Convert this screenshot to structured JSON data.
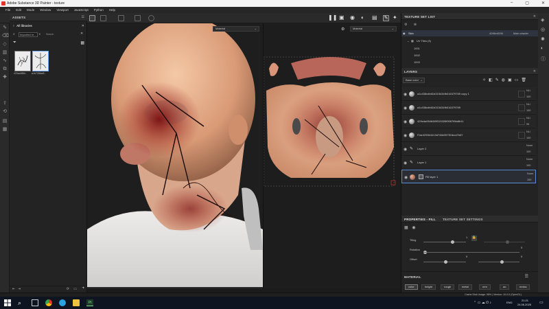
{
  "window": {
    "title": "Adobe Substance 3D Painter - texture"
  },
  "menu": [
    "File",
    "Edit",
    "Mode",
    "Window",
    "Viewport",
    "JavaScript",
    "Python",
    "Help"
  ],
  "assets": {
    "title": "ASSETS",
    "breadcrumb": "All libraries",
    "search_value": "Imported re...",
    "search_label": "Search",
    "thumbs": [
      {
        "label": "423ad48fd..."
      },
      {
        "label": "a1b728fae8..."
      }
    ]
  },
  "viewport3d": {
    "mode": "Material"
  },
  "viewport2d": {
    "mode": "Material"
  },
  "texture_set_list": {
    "title": "TEXTURE SET LIST",
    "set_name": "Skin",
    "resolution": "4096x4096",
    "shader": "Main shader",
    "uv_tiles_label": "UV Tiles (3)",
    "tiles": [
      "1001",
      "1002",
      "1003"
    ]
  },
  "layers": {
    "title": "LAYERS",
    "channel": "Base color",
    "items": [
      {
        "name": "a1c438cdb61b315434fb016379789 copy 1",
        "blend": "NLi",
        "opacity": "100"
      },
      {
        "name": "a1c438cdb61b315434fb016379789",
        "blend": "NLi",
        "opacity": "100"
      },
      {
        "name": "429eda954b589315326f9067f6bdfb11",
        "blend": "NLi",
        "opacity": "95"
      },
      {
        "name": "f7ae4290b1b13d748e397f01bcd7b67",
        "blend": "NLi",
        "opacity": "100"
      },
      {
        "name": "Layer 2",
        "blend": "Norm",
        "opacity": "100"
      },
      {
        "name": "Layer 1",
        "blend": "Norm",
        "opacity": "100"
      },
      {
        "name": "Fill layer 1",
        "blend": "Norm",
        "opacity": "100"
      }
    ]
  },
  "properties": {
    "tab_active": "PROPERTIES - FILL",
    "tab_other": "TEXTURE SET SETTINGS",
    "tiling_label": "Tiling",
    "tiling_value": "1",
    "rotation_label": "Rotation",
    "rotation_value": "0",
    "offset_label": "Offset",
    "offset_value_1": "0",
    "offset_value_2": "0",
    "material_title": "MATERIAL",
    "channels": [
      "color",
      "height",
      "rough",
      "metal",
      "nrm",
      "ao",
      "emiss"
    ],
    "active_channel": "color"
  },
  "status": {
    "text": "Cache Disk Usage:  98% | Version: 10.0.0 (OpenGL)"
  },
  "taskbar": {
    "lang": "ENG",
    "time": "21:21",
    "date": "24.06.2025"
  },
  "colors": {
    "accent": "#6fa8ff",
    "logo": "#e8322a"
  }
}
